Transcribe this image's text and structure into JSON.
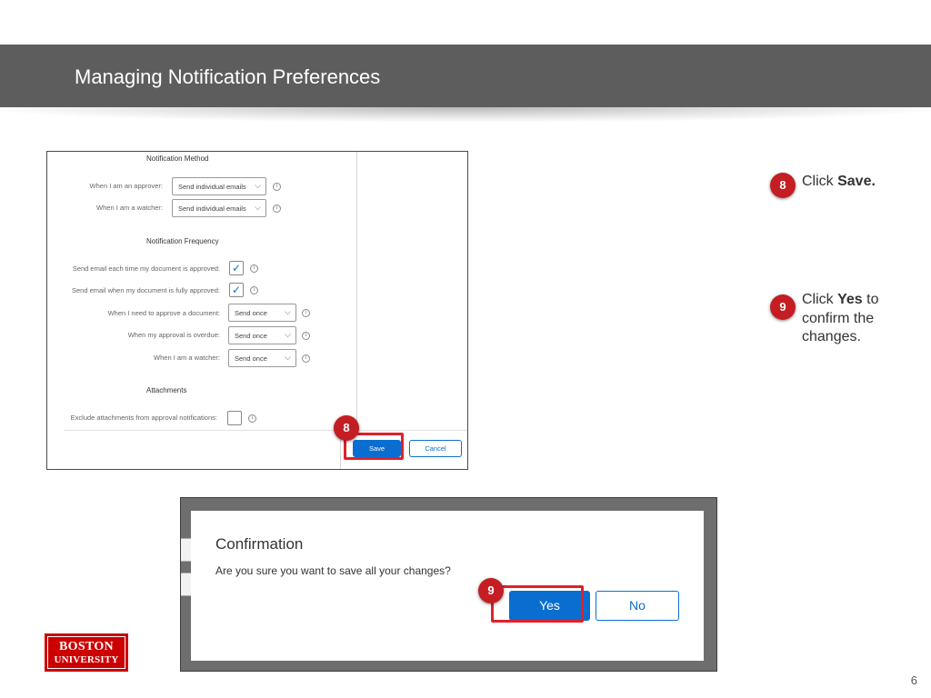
{
  "slide": {
    "title": "Managing Notification Preferences",
    "page_number": "6"
  },
  "screenshot_preferences": {
    "notification_method": {
      "heading": "Notification Method",
      "rows": [
        {
          "label": "When I am an approver:",
          "value": "Send individual emails"
        },
        {
          "label": "When I am a watcher:",
          "value": "Send individual emails"
        }
      ]
    },
    "notification_frequency": {
      "heading": "Notification Frequency",
      "checkbox_rows": [
        {
          "label": "Send email each time my document is approved:",
          "checked": true
        },
        {
          "label": "Send email when my document is fully approved:",
          "checked": true
        }
      ],
      "select_rows": [
        {
          "label": "When I need to approve a document:",
          "value": "Send once"
        },
        {
          "label": "When my approval is overdue:",
          "value": "Send once"
        },
        {
          "label": "When I am a watcher:",
          "value": "Send once"
        }
      ]
    },
    "attachments": {
      "heading": "Attachments",
      "row": {
        "label": "Exclude attachments from approval notifications:",
        "checked": false
      }
    },
    "buttons": {
      "save": "Save",
      "cancel": "Cancel"
    }
  },
  "confirmation_dialog": {
    "title": "Confirmation",
    "message": "Are you sure you want to save all your changes?",
    "yes_label": "Yes",
    "no_label": "No"
  },
  "steps": [
    {
      "number": "8",
      "prefix": "Click ",
      "bold": "Save.",
      "suffix": ""
    },
    {
      "number": "9",
      "prefix": "Click ",
      "bold": "Yes",
      "suffix": " to confirm the changes."
    }
  ],
  "logo": {
    "line1": "BOSTON",
    "line2": "UNIVERSITY"
  },
  "colors": {
    "title_bar": "#5d5d5d",
    "highlight": "#e0202a",
    "step_badge": "#c41e24",
    "primary_button": "#0a6ed1",
    "logo": "#cc0000"
  },
  "icons": [
    "info-icon",
    "chevron-down-icon",
    "checkmark-icon"
  ]
}
